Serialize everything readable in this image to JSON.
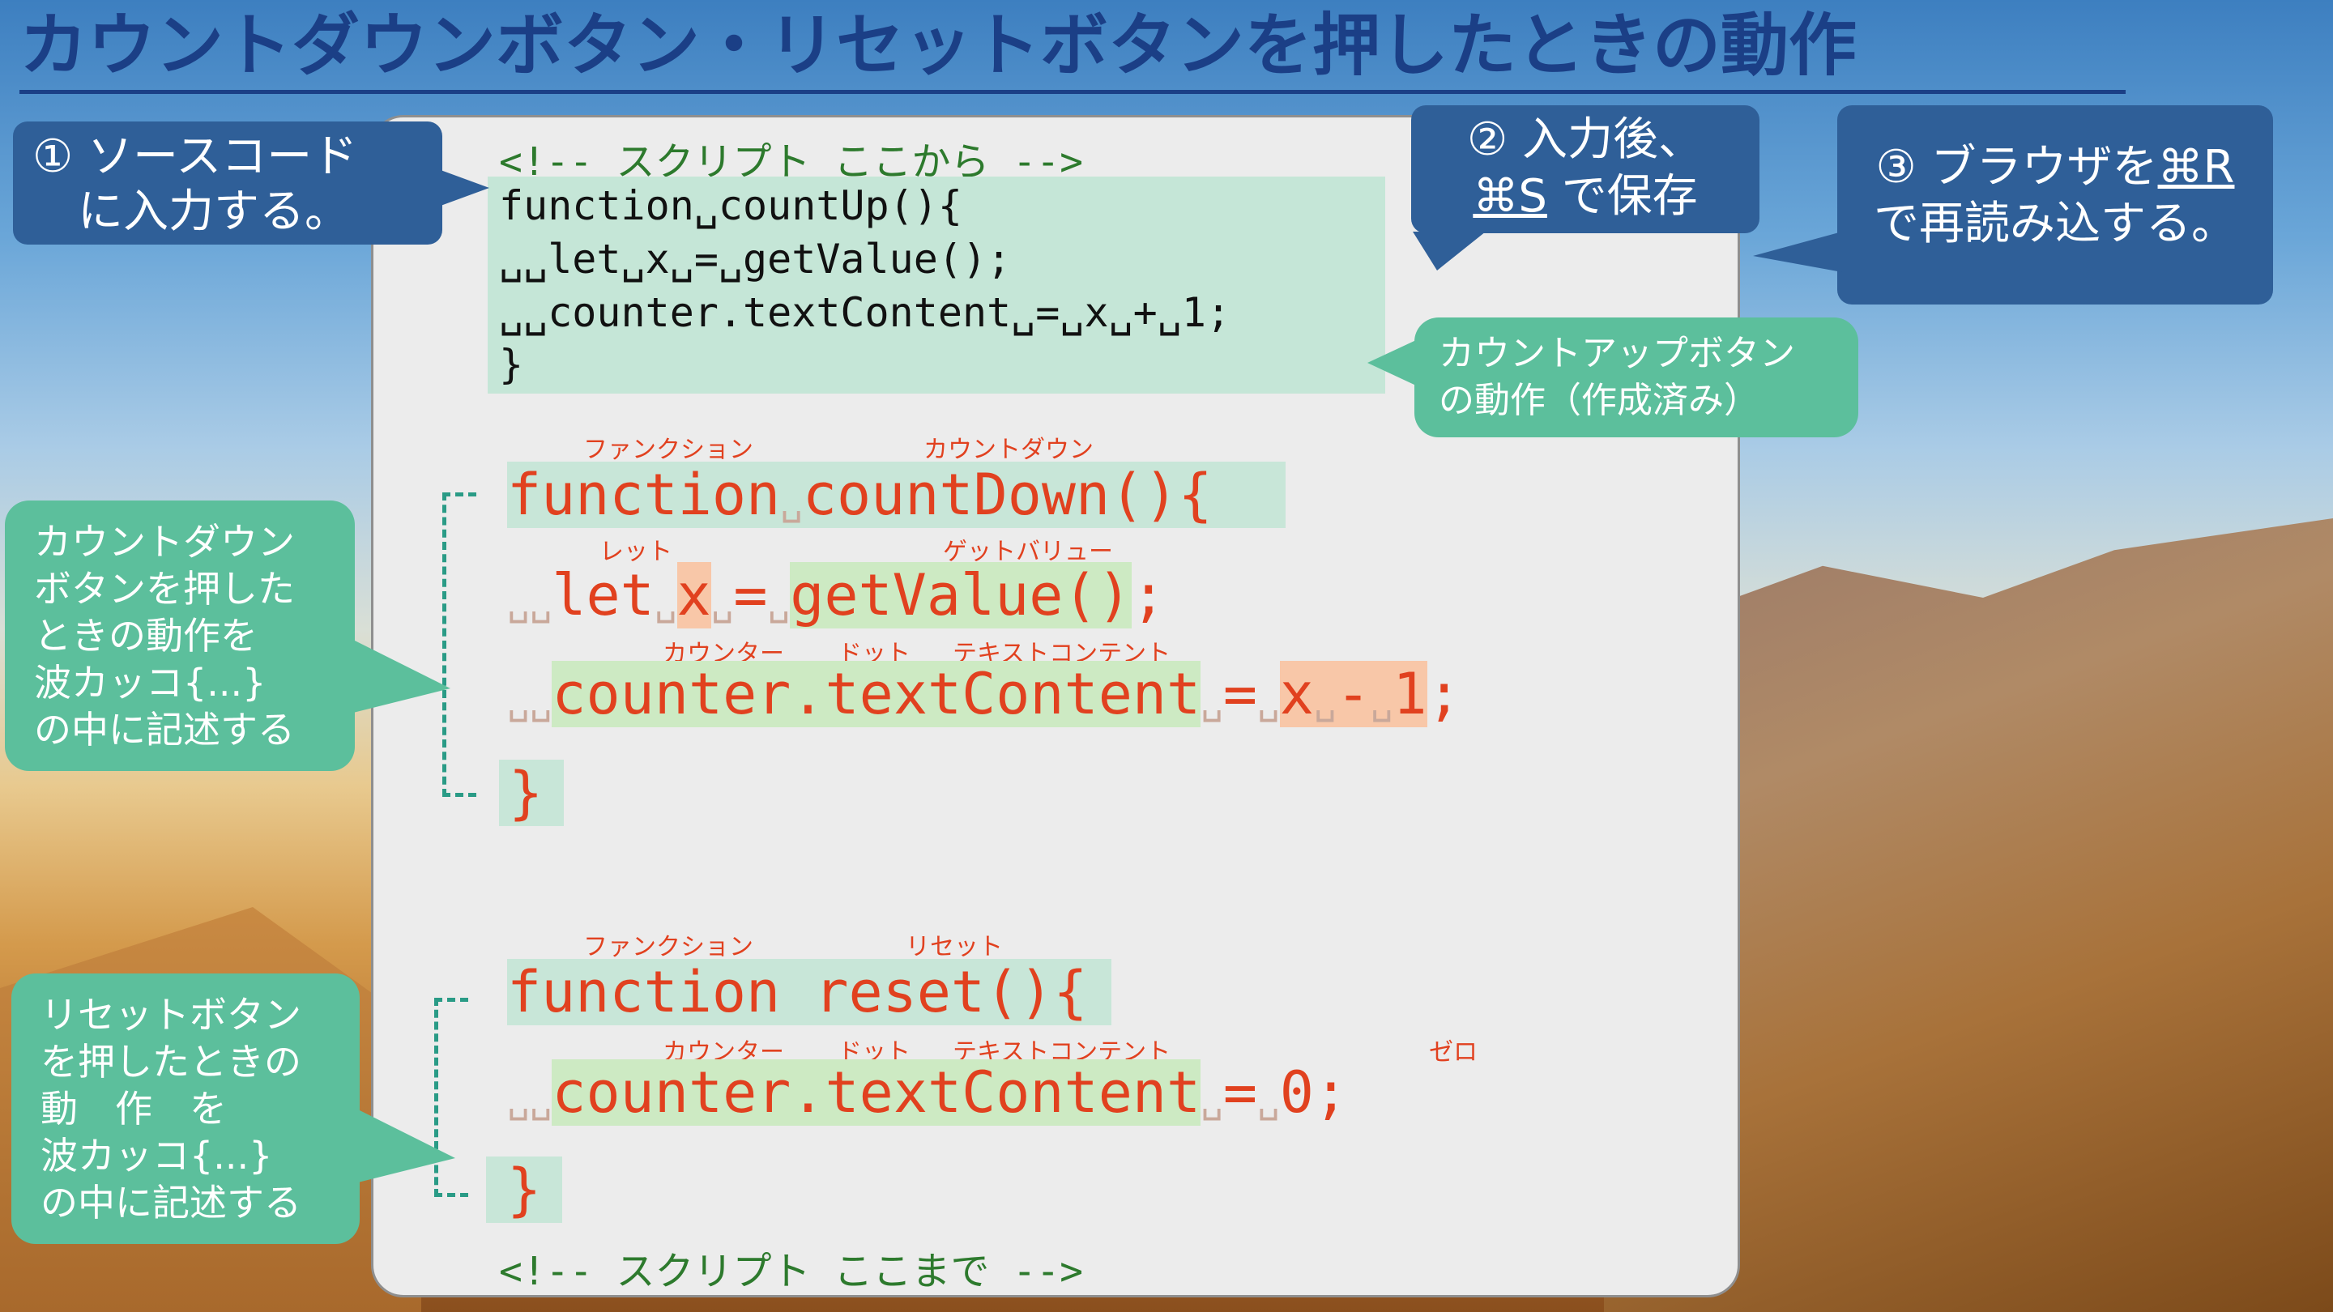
{
  "title": "カウントダウンボタン・リセットボタンを押したときの動作",
  "comments": {
    "start": "<!-- スクリプト ここから -->",
    "end": "<!-- スクリプト ここまで -->"
  },
  "countup_code": [
    "function␣countUp(){",
    "␣␣let␣x␣=␣getValue();",
    "␣␣counter.textContent␣=␣x␣+␣1;",
    "}"
  ],
  "countdown": {
    "line1": {
      "keyword": "function",
      "sp": "␣",
      "name": "countDown(){"
    },
    "line2": {
      "indent": "␣␣",
      "keyword": "let",
      "sp1": "␣",
      "var": "x",
      "sp2": "␣",
      "eq": "=",
      "sp3": "␣",
      "call": "getValue()",
      "semi": ";"
    },
    "line3": {
      "indent": "␣␣",
      "target": "counter.textContent",
      "sp1": "␣",
      "eq": "=",
      "sp2": "␣",
      "expr_x": "x",
      "sp3": "␣",
      "minus": "-",
      "sp4": "␣",
      "one": "1",
      "semi": ";"
    },
    "line4": "}"
  },
  "reset": {
    "line1": {
      "keyword": "function",
      "name": "reset(){"
    },
    "line2": {
      "indent": "␣␣",
      "target": "counter.textContent",
      "sp1": "␣",
      "eq": "=",
      "sp2": "␣",
      "zero": "0",
      "semi": ";"
    },
    "line3": "}"
  },
  "ruby": {
    "function1": "ファンクション",
    "countdown": "カウントダウン",
    "let": "レット",
    "getvalue": "ゲットバリュー",
    "counter1": "カウンター",
    "dot1": "ドット",
    "textcontent1": "テキストコンテント",
    "function2": "ファンクション",
    "reset": "リセット",
    "counter2": "カウンター",
    "dot2": "ドット",
    "textcontent2": "テキストコンテント",
    "zero": "ゼロ"
  },
  "callouts": {
    "step1": "① ソースコード\n　に入力する。",
    "step2_line1": "② 入力後、",
    "step2_key": "⌘S",
    "step2_rest": " で保存",
    "step3_line1_pre": "③ ブラウザを",
    "step3_key": "⌘R",
    "step3_line2": "で再読み込する。",
    "countup_note": "カウントアップボタン\nの動作（作成済み）",
    "countdown_note": "カウントダウン\nボタンを押した\nときの動作を\n波カッコ{...}\nの中に記述する",
    "reset_note": "リセットボタン\nを押したときの\n動　作　を\n波カッコ{...}\nの中に記述する"
  },
  "colors": {
    "title": "#1b3f86",
    "callout_blue": "#2f5f98",
    "callout_teal": "#5cbf9c",
    "code_red": "#e1411f",
    "comment_green": "#2d7a2d"
  }
}
